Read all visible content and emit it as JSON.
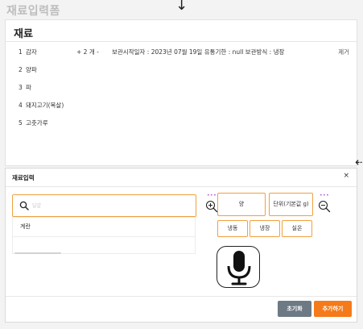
{
  "page": {
    "title": "재료입력폼"
  },
  "card": {
    "title": "재료",
    "ingredients": [
      {
        "num": "1",
        "name": "감자",
        "qty": "+ 2 개 -",
        "info": "보관시작일자 : 2023년 07월 19일  유통기한 : null 보관방식 : 냉장",
        "delete_label": "제거"
      },
      {
        "num": "2",
        "name": "양파"
      },
      {
        "num": "3",
        "name": "파"
      },
      {
        "num": "4",
        "name": "돼지고기(목살)"
      },
      {
        "num": "5",
        "name": "고춧가루"
      }
    ]
  },
  "modal": {
    "title": "재료입력",
    "close_label": "×",
    "search": {
      "placeholder": "달걀",
      "value": ""
    },
    "results": [
      "계란"
    ],
    "options": {
      "count_label": "양",
      "unit_label": "단위(기본값 g)",
      "storage": [
        "냉동",
        "냉장",
        "실온"
      ]
    },
    "reset_label": "초기화",
    "add_label": "추가하기"
  },
  "colors": {
    "accent": "#f47a1a",
    "border_accent": "#f0a040",
    "secondary_button": "#6d7a85",
    "dots": "#b44fd8"
  },
  "icons": {
    "search": "search-icon",
    "zoom_in": "zoom-in-icon",
    "zoom_out": "zoom-out-icon",
    "mic": "microphone-icon",
    "close": "close-icon",
    "arrow_down": "arrow-down-icon",
    "arrow_left": "arrow-left-icon"
  }
}
